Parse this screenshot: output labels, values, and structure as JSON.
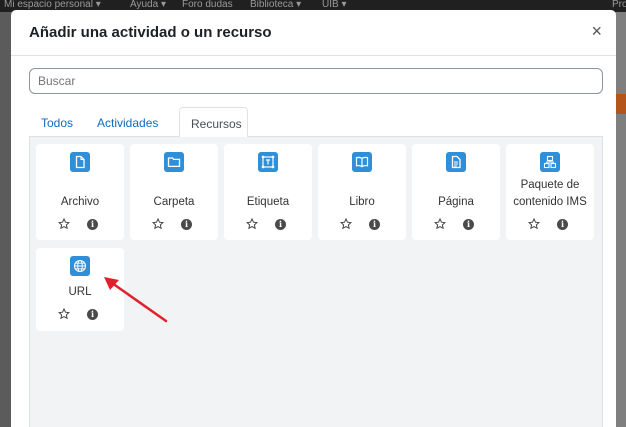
{
  "background": {
    "nav_items": [
      "Mi espacio personal ▾",
      "Ayuda ▾",
      "Foro dudas",
      "Biblioteca ▾",
      "UIB ▾"
    ],
    "right_label": "Pro"
  },
  "modal": {
    "title": "Añadir una actividad o un recurso",
    "close_label": "×",
    "search_placeholder": "Buscar",
    "tabs": [
      {
        "label": "Todos",
        "active": false
      },
      {
        "label": "Actividades",
        "active": false
      },
      {
        "label": "Recursos",
        "active": true
      }
    ],
    "items": [
      {
        "name": "Archivo",
        "icon": "file-icon"
      },
      {
        "name": "Carpeta",
        "icon": "folder-icon"
      },
      {
        "name": "Etiqueta",
        "icon": "label-icon"
      },
      {
        "name": "Libro",
        "icon": "book-icon"
      },
      {
        "name": "Página",
        "icon": "page-icon"
      },
      {
        "name": "Paquete de contenido IMS",
        "icon": "package-icon"
      },
      {
        "name": "URL",
        "icon": "globe-icon"
      }
    ]
  },
  "colors": {
    "accent": "#0f6cbf",
    "icon_bg": "#2f8fd8",
    "annotation_arrow": "#e0212b"
  }
}
